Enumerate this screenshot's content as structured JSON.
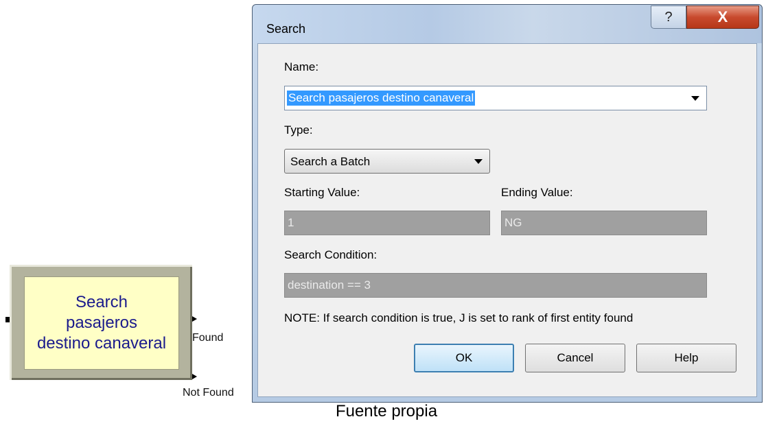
{
  "module": {
    "title_lines": [
      "Search",
      "pasajeros",
      "destino canaveral"
    ],
    "exit_found_label": "Found",
    "exit_not_found_label": "Not Found"
  },
  "dialog": {
    "title": "Search",
    "help_icon": "?",
    "close_icon": "X",
    "name_label": "Name:",
    "name_value": "Search pasajeros destino canaveral",
    "type_label": "Type:",
    "type_value": "Search a Batch",
    "starting_label": "Starting Value:",
    "starting_value": "1",
    "ending_label": "Ending Value:",
    "ending_value": "NG",
    "condition_label": "Search Condition:",
    "condition_value": "destination == 3",
    "note": "NOTE: If search condition is true, J is set to rank of first entity found",
    "ok_label": "OK",
    "cancel_label": "Cancel",
    "help_label": "Help"
  },
  "caption": "Fuente propia",
  "colors": {
    "module_face": "#ffffc6",
    "module_text": "#1a1a8c",
    "selection": "#3399ff",
    "close_button": "#c84a2e"
  }
}
